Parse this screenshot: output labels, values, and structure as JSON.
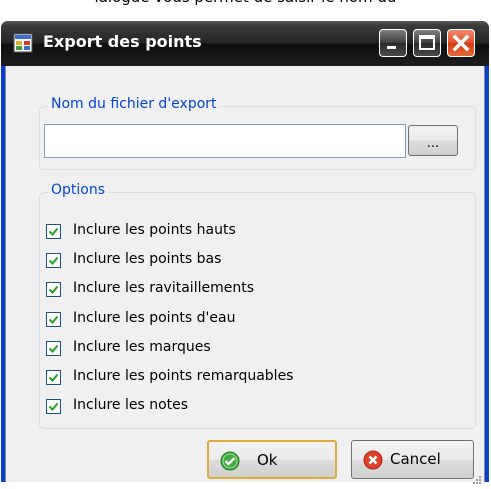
{
  "background_text": "ialogue vous permet de saisir le nom du",
  "window": {
    "title": "Export des points",
    "title_icon": "app-icon",
    "controls": [
      "minimize-icon",
      "maximize-icon",
      "close-icon"
    ]
  },
  "export_group": {
    "legend": "Nom du fichier d'export",
    "file_value": "",
    "browse_label": "..."
  },
  "options_group": {
    "legend": "Options",
    "items": [
      {
        "label": "Inclure les points hauts",
        "checked": true
      },
      {
        "label": "Inclure les points bas",
        "checked": true
      },
      {
        "label": "Inclure les ravitaillements",
        "checked": true
      },
      {
        "label": "Inclure les points d'eau",
        "checked": true
      },
      {
        "label": "Inclure les marques",
        "checked": true
      },
      {
        "label": "Inclure les points remarquables",
        "checked": true
      },
      {
        "label": "Inclure les notes",
        "checked": true
      }
    ]
  },
  "buttons": {
    "ok_label": "Ok",
    "cancel_label": "Cancel",
    "ok_icon": "check-circle-icon",
    "cancel_icon": "cancel-circle-icon"
  },
  "colors": {
    "legend_text": "#0046d5",
    "title_text": "#ffffff",
    "close_button": "#d9431a",
    "default_button_border": "#e1a93d"
  }
}
